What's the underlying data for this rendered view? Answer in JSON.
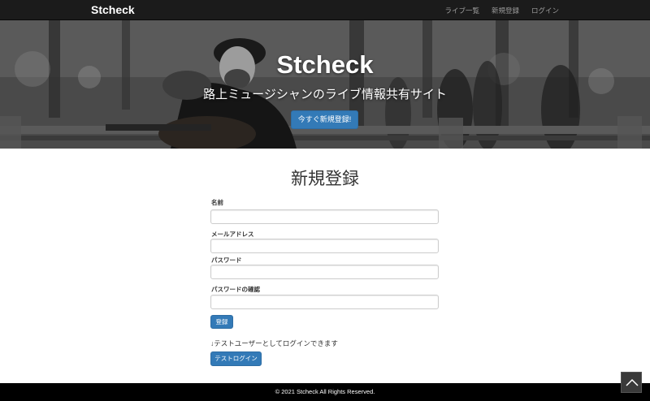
{
  "navbar": {
    "brand": "Stcheck",
    "links": [
      {
        "label": "ライブ一覧"
      },
      {
        "label": "新規登録"
      },
      {
        "label": "ログイン"
      }
    ]
  },
  "hero": {
    "title": "Stcheck",
    "subtitle": "路上ミュージシャンのライブ情報共有サイト",
    "cta_label": "今すぐ新規登録!"
  },
  "form": {
    "title": "新規登録",
    "fields": [
      {
        "label": "名前",
        "value": "",
        "type": "text"
      },
      {
        "label": "メールアドレス",
        "value": "",
        "type": "email"
      },
      {
        "label": "パスワード",
        "value": "",
        "type": "password"
      },
      {
        "label": "パスワードの確認",
        "value": "",
        "type": "password"
      }
    ],
    "submit_label": "登録",
    "hint": "↓テストユーザーとしてログインできます",
    "test_login_label": "テストログイン"
  },
  "footer": {
    "copyright": "© 2021 Stcheck All Rights Reserved."
  },
  "icons": {
    "scroll_top": "chevron-up-icon"
  },
  "colors": {
    "navbar_bg": "#1b1b1b",
    "primary": "#337ab7",
    "footer_bg": "#000000"
  }
}
